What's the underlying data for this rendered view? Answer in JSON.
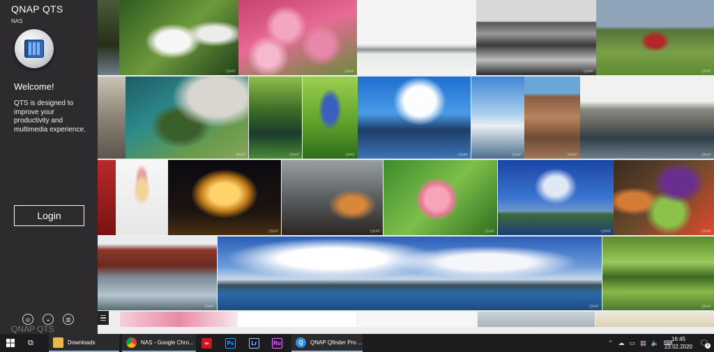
{
  "panel": {
    "brand_qnap": "QNAP",
    "brand_qts": "QTS",
    "device_label": "NAS",
    "welcome": "Welcome!",
    "description": "QTS is designed to improve your productivity and multimedia experience.",
    "login_label": "Login",
    "footer_brand": "QNAP QTS"
  },
  "photo_wall": {
    "watermark": "QNAP",
    "tiles": [
      "forest-lake",
      "white-flowers",
      "cherry-blossom",
      "misty-pier",
      "rocky-coast",
      "tractor-field",
      "building-edge",
      "heart-stone-weir",
      "forest-stream",
      "blue-orchid",
      "over-water-bungalows",
      "harbor-boats",
      "rock-ridge",
      "canal-warehouses",
      "red-edge",
      "ice-cream-cone",
      "carousel-night",
      "rainy-window",
      "pink-rose",
      "blue-sky-island",
      "roasted-vegetables",
      "dark-edge",
      "brick-canal",
      "panorama-sea",
      "tree-river",
      "blossom-bottom",
      "white-bottom",
      "sky-bottom",
      "powerline-bottom"
    ]
  },
  "taskbar": {
    "items": [
      {
        "label": "Downloads",
        "icon": "folder-icon"
      },
      {
        "label": "NAS - Google Chro...",
        "icon": "chrome-icon"
      },
      {
        "label": "",
        "icon": "creative-cloud-icon"
      },
      {
        "label": "Ps",
        "icon": "photoshop-icon"
      },
      {
        "label": "Lr",
        "icon": "lightroom-icon"
      },
      {
        "label": "Ru",
        "icon": "rush-icon"
      },
      {
        "label": "QNAP Qfinder Pro ...",
        "icon": "qfinder-icon"
      }
    ],
    "time": "16:45",
    "date": "23.02.2020",
    "notification_count": "3"
  },
  "colors": {
    "taskbar": "#1c1c1e",
    "accent": "#8ab4e6",
    "panel": "#0e0a0e"
  }
}
